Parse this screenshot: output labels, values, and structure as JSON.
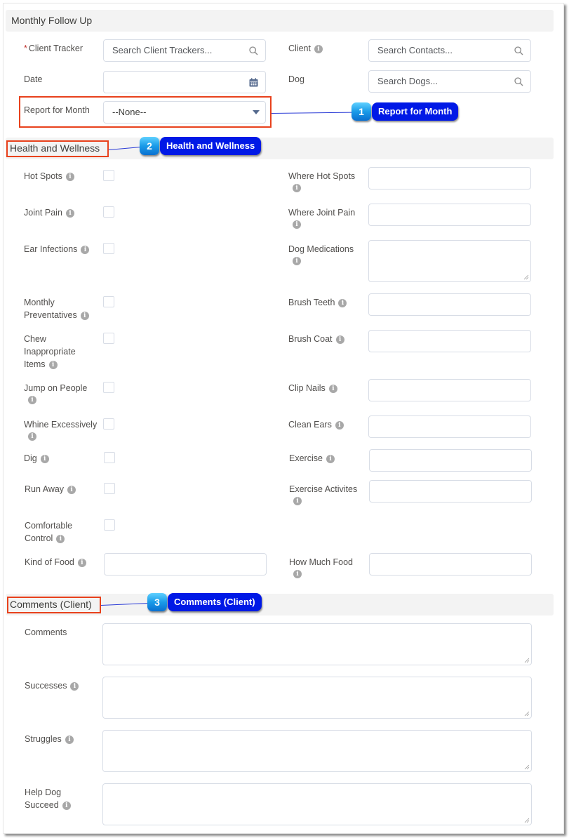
{
  "sections": {
    "monthly_follow_up": "Monthly Follow Up",
    "health_and_wellness": "Health and Wellness",
    "comments_client": "Comments (Client)"
  },
  "monthly": {
    "client_tracker": {
      "label": "Client Tracker",
      "required_marker": "*",
      "placeholder": "Search Client Trackers...",
      "icon": "search-icon"
    },
    "client": {
      "label": "Client",
      "placeholder": "Search Contacts...",
      "icon": "search-icon"
    },
    "date": {
      "label": "Date",
      "value": "",
      "icon": "calendar-icon"
    },
    "dog": {
      "label": "Dog",
      "placeholder": "Search Dogs...",
      "icon": "search-icon"
    },
    "report_for_month": {
      "label": "Report for Month",
      "selected": "--None--",
      "icon": "chevron-down-icon"
    }
  },
  "health": {
    "left": [
      {
        "label": "Hot Spots",
        "checked": false
      },
      {
        "label": "Joint Pain",
        "checked": false
      },
      {
        "label": "Ear Infections",
        "checked": false
      },
      {
        "label_line1": "Monthly",
        "label_line2": "Preventatives",
        "checked": false
      },
      {
        "label_line1": "Chew",
        "label_line2": "Inappropriate",
        "label_line3": "Items",
        "checked": false
      },
      {
        "label": "Jump on People",
        "checked": false
      },
      {
        "label": "Whine Excessively",
        "checked": false
      },
      {
        "label": "Dig",
        "checked": false
      },
      {
        "label": "Run Away",
        "checked": false
      },
      {
        "label_line1": "Comfortable",
        "label_line2": "Control",
        "checked": false
      },
      {
        "label": "Kind of Food",
        "value": ""
      }
    ],
    "right": [
      {
        "label": "Where Hot Spots",
        "value": ""
      },
      {
        "label": "Where Joint Pain",
        "value": ""
      },
      {
        "label": "Dog Medications",
        "value": ""
      },
      {
        "label": "Brush Teeth",
        "value": ""
      },
      {
        "label": "Brush Coat",
        "value": ""
      },
      {
        "label": "Clip Nails",
        "value": ""
      },
      {
        "label": "Clean Ears",
        "value": ""
      },
      {
        "label": "Exercise",
        "value": ""
      },
      {
        "label": "Exercise Activites",
        "value": ""
      },
      {
        "label": "How Much Food",
        "value": ""
      }
    ]
  },
  "comments": [
    {
      "label": "Comments",
      "value": ""
    },
    {
      "label": "Successes",
      "value": ""
    },
    {
      "label": "Struggles",
      "value": ""
    },
    {
      "label_line1": "Help Dog",
      "label_line2": "Succeed",
      "value": ""
    }
  ],
  "callouts": [
    {
      "number": "1",
      "label": "Report for Month"
    },
    {
      "number": "2",
      "label": "Health and Wellness"
    },
    {
      "number": "3",
      "label": "Comments (Client)"
    }
  ],
  "info_glyph": "i"
}
